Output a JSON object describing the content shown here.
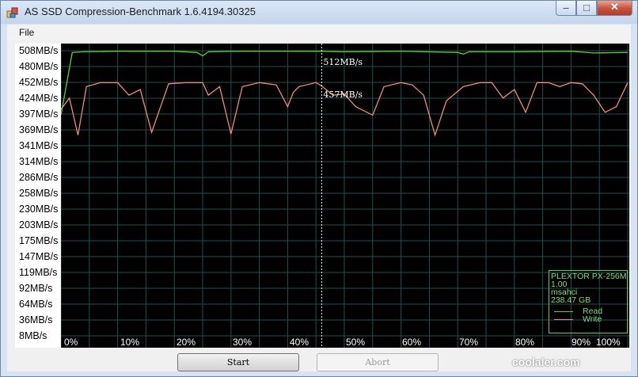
{
  "window": {
    "title": "AS SSD Compression-Benchmark 1.6.4194.30325",
    "minimize_glyph": "–",
    "maximize_glyph": "□",
    "close_glyph": "✕"
  },
  "menu": {
    "file_label": "File"
  },
  "markers": {
    "read_label": "512MB/s",
    "write_label": "457MB/s",
    "cursor_percent": 46
  },
  "legend": {
    "drive": "PLEXTOR PX-256M",
    "firmware": "1.00",
    "driver": "msahci",
    "capacity": "238.47 GB",
    "read_label": "Read",
    "write_label": "Write"
  },
  "buttons": {
    "start_label": "Start",
    "abort_label": "Abort"
  },
  "watermark": "coolaler.com",
  "colors": {
    "read": "#5fcb3b",
    "write": "#f08a7a",
    "grid": "#1f4f52",
    "background": "#000000"
  },
  "chart_data": {
    "type": "line",
    "y_tick_labels": [
      "508MB/s",
      "480MB/s",
      "452MB/s",
      "424MB/s",
      "397MB/s",
      "369MB/s",
      "341MB/s",
      "314MB/s",
      "286MB/s",
      "258MB/s",
      "230MB/s",
      "203MB/s",
      "175MB/s",
      "147MB/s",
      "119MB/s",
      "92MB/s",
      "64MB/s",
      "36MB/s",
      "8MB/s"
    ],
    "x_tick_labels": [
      "0%",
      "10%",
      "20%",
      "30%",
      "40%",
      "50%",
      "60%",
      "70%",
      "80%",
      "90%",
      "100%"
    ],
    "ylim": [
      8,
      508
    ],
    "xlim": [
      0,
      100
    ],
    "grid": true,
    "legend_position": "bottom-right",
    "series": [
      {
        "name": "Read",
        "x": [
          0,
          2,
          4,
          10,
          20,
          24,
          25,
          26,
          30,
          40,
          46,
          50,
          60,
          70,
          71,
          72,
          80,
          90,
          94,
          100
        ],
        "y": [
          395,
          505,
          506,
          507,
          507,
          505,
          499,
          506,
          507,
          507,
          507,
          506,
          507,
          505,
          502,
          506,
          506,
          507,
          504,
          505
        ]
      },
      {
        "name": "Write",
        "x": [
          0,
          1.5,
          3,
          4.5,
          7,
          10,
          12,
          14,
          16,
          19,
          22,
          25,
          26,
          28,
          30,
          32,
          35,
          38,
          40,
          41,
          42,
          45,
          46,
          48,
          50,
          52,
          55,
          57,
          60,
          62,
          64,
          66,
          68,
          71,
          74,
          76,
          78,
          80,
          82,
          84,
          86,
          88,
          90,
          92,
          94,
          96,
          98,
          100
        ],
        "y": [
          405,
          425,
          360,
          445,
          452,
          452,
          430,
          440,
          365,
          450,
          452,
          452,
          430,
          445,
          362,
          445,
          452,
          448,
          410,
          435,
          445,
          452,
          446,
          430,
          432,
          410,
          395,
          445,
          452,
          448,
          430,
          360,
          420,
          445,
          452,
          452,
          425,
          440,
          400,
          452,
          452,
          445,
          452,
          450,
          430,
          400,
          410,
          452
        ]
      }
    ]
  }
}
